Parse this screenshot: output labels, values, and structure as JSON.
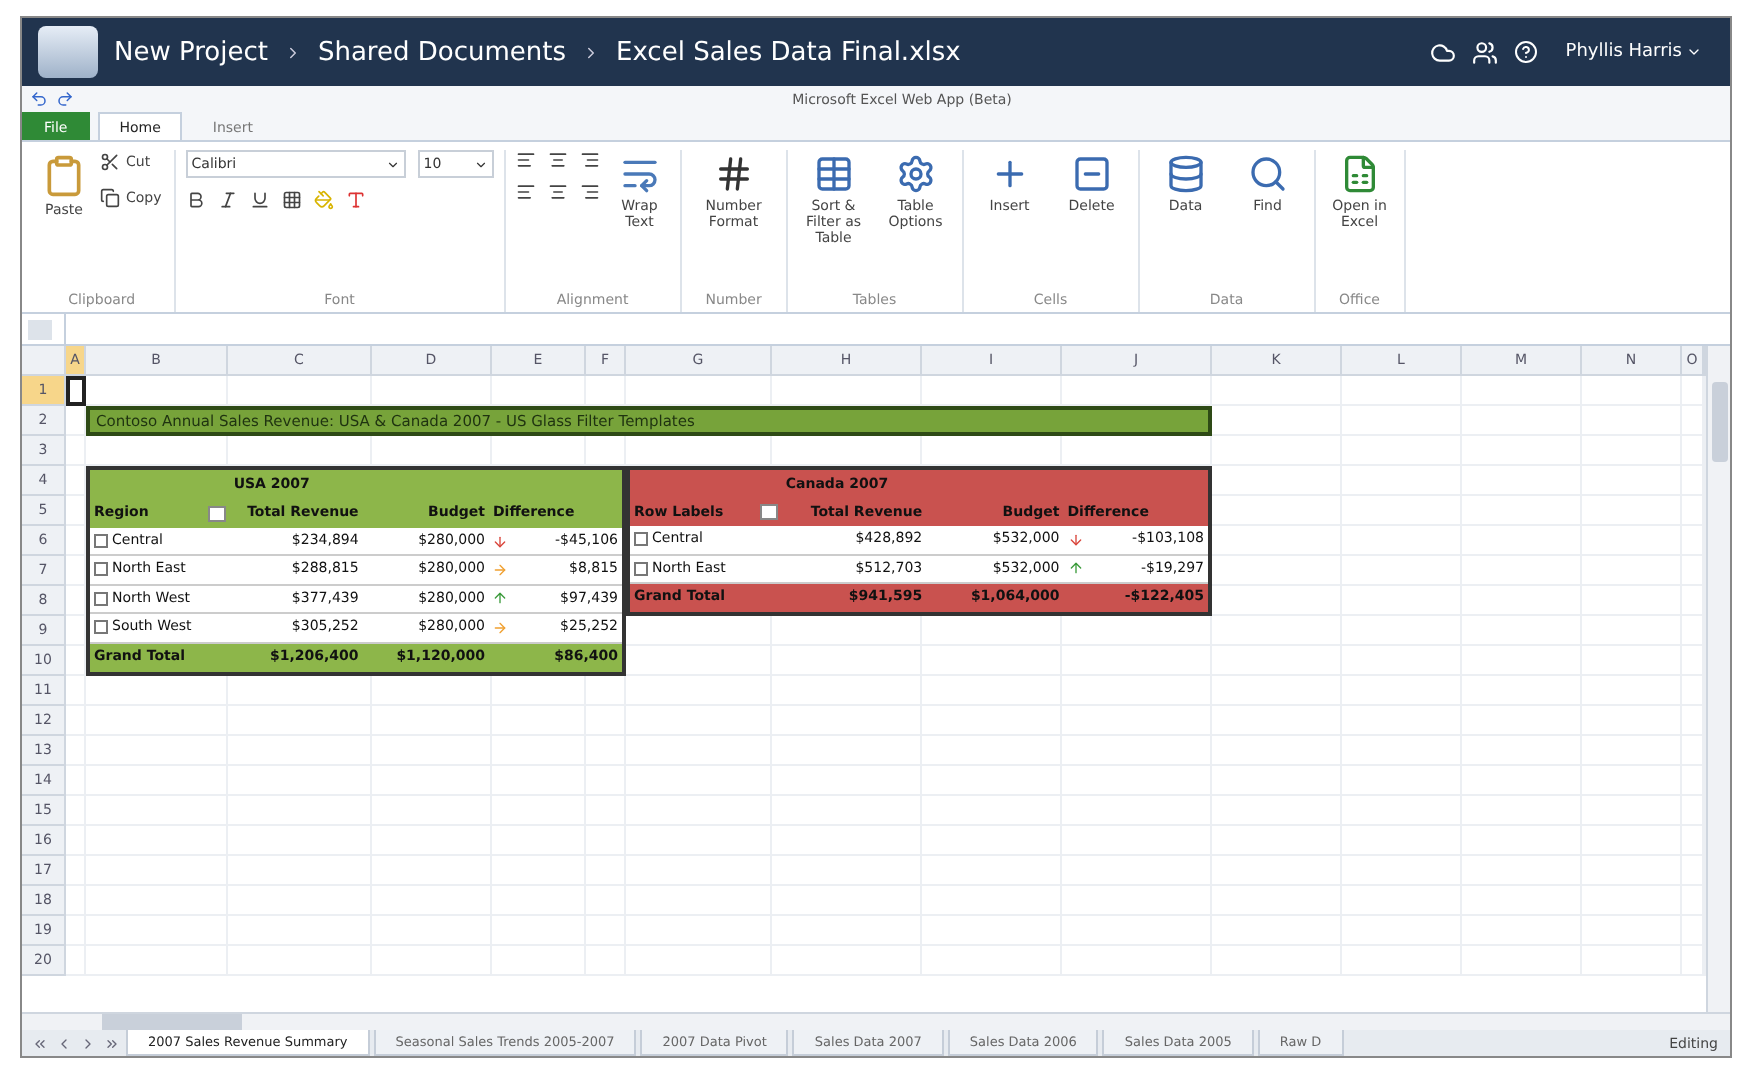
{
  "title_bar": {
    "breadcrumb": [
      {
        "label": "New Project"
      },
      {
        "label": "Shared Documents"
      },
      {
        "label": "Excel Sales Data Final.xlsx"
      }
    ],
    "user": "Phyllis Harris"
  },
  "app_title": "Microsoft Excel Web App (Beta)",
  "ribbon_tabs": [
    {
      "label": "File",
      "kind": "file",
      "selected": false
    },
    {
      "label": "Home",
      "kind": "tab",
      "selected": true
    },
    {
      "label": "Insert",
      "kind": "tab",
      "selected": false
    }
  ],
  "ribbon": {
    "groups": [
      {
        "label": "Clipboard",
        "kind": "clipboard",
        "items": [
          "Paste",
          "Cut",
          "Copy"
        ]
      },
      {
        "label": "Font",
        "kind": "font",
        "items": [
          "Calibri",
          "10"
        ]
      },
      {
        "label": "Alignment",
        "kind": "alignment",
        "items": [
          "Wrap Text"
        ]
      },
      {
        "label": "Number",
        "kind": "number",
        "items": [
          "Number Format"
        ]
      },
      {
        "label": "Tables",
        "kind": "big",
        "items": [
          "Sort & Filter as Table",
          "Table Options"
        ]
      },
      {
        "label": "Cells",
        "kind": "big",
        "items": [
          "Insert",
          "Delete"
        ]
      },
      {
        "label": "Data",
        "kind": "big",
        "items": [
          "Data",
          "Find"
        ]
      },
      {
        "label": "Office",
        "kind": "big",
        "items": [
          "Open in Excel"
        ]
      }
    ]
  },
  "columns": [
    {
      "label": "A",
      "selected": true
    },
    {
      "label": "B",
      "selected": false
    },
    {
      "label": "C",
      "selected": false
    },
    {
      "label": "D",
      "selected": false
    },
    {
      "label": "E",
      "selected": false
    },
    {
      "label": "F",
      "selected": false
    },
    {
      "label": "G",
      "selected": false
    },
    {
      "label": "H",
      "selected": false
    },
    {
      "label": "I",
      "selected": false
    },
    {
      "label": "J",
      "selected": false
    },
    {
      "label": "K",
      "selected": false
    },
    {
      "label": "L",
      "selected": false
    },
    {
      "label": "M",
      "selected": false
    },
    {
      "label": "N",
      "selected": false
    },
    {
      "label": "O",
      "selected": false
    }
  ],
  "rows": [
    {
      "label": "1",
      "selected": true
    },
    {
      "label": "2",
      "selected": false
    },
    {
      "label": "3",
      "selected": false
    },
    {
      "label": "4",
      "selected": false
    },
    {
      "label": "5",
      "selected": false
    },
    {
      "label": "6",
      "selected": false
    },
    {
      "label": "7",
      "selected": false
    },
    {
      "label": "8",
      "selected": false
    },
    {
      "label": "9",
      "selected": false
    },
    {
      "label": "10",
      "selected": false
    },
    {
      "label": "11",
      "selected": false
    },
    {
      "label": "12",
      "selected": false
    },
    {
      "label": "13",
      "selected": false
    },
    {
      "label": "14",
      "selected": false
    },
    {
      "label": "15",
      "selected": false
    },
    {
      "label": "16",
      "selected": false
    },
    {
      "label": "17",
      "selected": false
    },
    {
      "label": "18",
      "selected": false
    },
    {
      "label": "19",
      "selected": false
    },
    {
      "label": "20",
      "selected": false
    }
  ],
  "banner": "Contoso Annual Sales Revenue: USA & Canada 2007 - US Glass Filter Templates",
  "pivots": [
    {
      "color": "#8db64a",
      "caption": "USA 2007",
      "headers": [
        "Region",
        "Total Revenue",
        "Budget",
        "Difference"
      ],
      "rows": [
        {
          "cells": [
            "Central",
            "$234,894",
            "$280,000",
            "-$45,106"
          ],
          "kind": "down"
        },
        {
          "cells": [
            "North East",
            "$288,815",
            "$280,000",
            "$8,815"
          ],
          "kind": "flat"
        },
        {
          "cells": [
            "North West",
            "$377,439",
            "$280,000",
            "$97,439"
          ],
          "kind": "up"
        },
        {
          "cells": [
            "South West",
            "$305,252",
            "$280,000",
            "$25,252"
          ],
          "kind": "flat"
        }
      ],
      "total": [
        "Grand Total",
        "$1,206,400",
        "$1,120,000",
        "$86,400"
      ]
    },
    {
      "color": "#c9524f",
      "caption": "Canada 2007",
      "headers": [
        "Row Labels",
        "Total Revenue",
        "Budget",
        "Difference"
      ],
      "rows": [
        {
          "cells": [
            "Central",
            "$428,892",
            "$532,000",
            "-$103,108"
          ],
          "kind": "down"
        },
        {
          "cells": [
            "North East",
            "$512,703",
            "$532,000",
            "-$19,297"
          ],
          "kind": "up"
        }
      ],
      "total": [
        "Grand Total",
        "$941,595",
        "$1,064,000",
        "-$122,405"
      ]
    }
  ],
  "sheet_tabs": [
    {
      "label": "2007 Sales Revenue Summary",
      "selected": true
    },
    {
      "label": "Seasonal Sales Trends 2005-2007",
      "selected": false
    },
    {
      "label": "2007 Data Pivot",
      "selected": false
    },
    {
      "label": "Sales Data 2007",
      "selected": false
    },
    {
      "label": "Sales Data 2006",
      "selected": false
    },
    {
      "label": "Sales Data 2005",
      "selected": false
    },
    {
      "label": "Raw D",
      "selected": false
    }
  ],
  "status": "Editing"
}
